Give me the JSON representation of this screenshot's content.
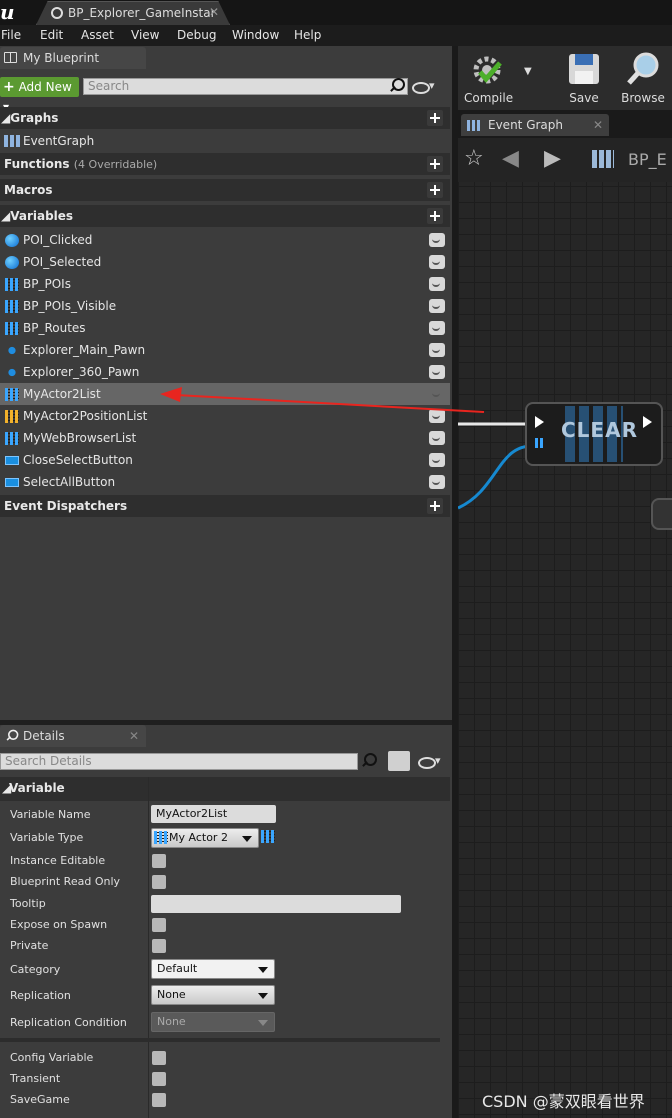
{
  "window": {
    "tab_title": "BP_Explorer_GameInstanc"
  },
  "menu": [
    "File",
    "Edit",
    "Asset",
    "View",
    "Debug",
    "Window",
    "Help"
  ],
  "my_blueprint": {
    "tab": "My Blueprint",
    "add_new": "Add New",
    "search_placeholder": "Search",
    "sections": {
      "graphs": "Graphs",
      "functions": "Functions",
      "functions_sub": "(4 Overridable)",
      "macros": "Macros",
      "variables": "Variables",
      "event_dispatchers": "Event Dispatchers"
    },
    "graph_items": [
      "EventGraph"
    ],
    "variables": [
      {
        "name": "POI_Clicked",
        "icon": "bool-icon"
      },
      {
        "name": "POI_Selected",
        "icon": "bool-icon"
      },
      {
        "name": "BP_POIs",
        "icon": "array-icon"
      },
      {
        "name": "BP_POIs_Visible",
        "icon": "array-icon"
      },
      {
        "name": "BP_Routes",
        "icon": "array-icon"
      },
      {
        "name": "Explorer_Main_Pawn",
        "icon": "pawn-icon"
      },
      {
        "name": "Explorer_360_Pawn",
        "icon": "pawn-icon"
      },
      {
        "name": "MyActor2List",
        "icon": "array-icon",
        "selected": true
      },
      {
        "name": "MyActor2PositionList",
        "icon": "array-struct-icon"
      },
      {
        "name": "MyWebBrowserList",
        "icon": "array-icon"
      },
      {
        "name": "CloseSelectButton",
        "icon": "object-icon"
      },
      {
        "name": "SelectAllButton",
        "icon": "object-icon"
      }
    ]
  },
  "details": {
    "tab": "Details",
    "search_placeholder": "Search Details",
    "category": "Variable",
    "labels": {
      "variable_name": "Variable Name",
      "variable_type": "Variable Type",
      "instance_editable": "Instance Editable",
      "blueprint_read_only": "Blueprint Read Only",
      "tooltip": "Tooltip",
      "expose_on_spawn": "Expose on Spawn",
      "private": "Private",
      "category": "Category",
      "replication": "Replication",
      "replication_condition": "Replication Condition",
      "config_variable": "Config Variable",
      "transient": "Transient",
      "savegame": "SaveGame"
    },
    "values": {
      "variable_name": "MyActor2List",
      "variable_type": "My Actor 2",
      "category": "Default",
      "replication": "None",
      "replication_condition": "None"
    }
  },
  "toolbar": {
    "compile": "Compile",
    "save": "Save",
    "browse": "Browse"
  },
  "graph": {
    "tab": "Event Graph",
    "breadcrumb": "BP_E",
    "node_title": "CLEAR"
  },
  "watermark": "CSDN @蒙双眼看世界",
  "colors": {
    "accent_green": "#5b9a31",
    "arrow_red": "#e8251f",
    "selection": "#666666"
  }
}
